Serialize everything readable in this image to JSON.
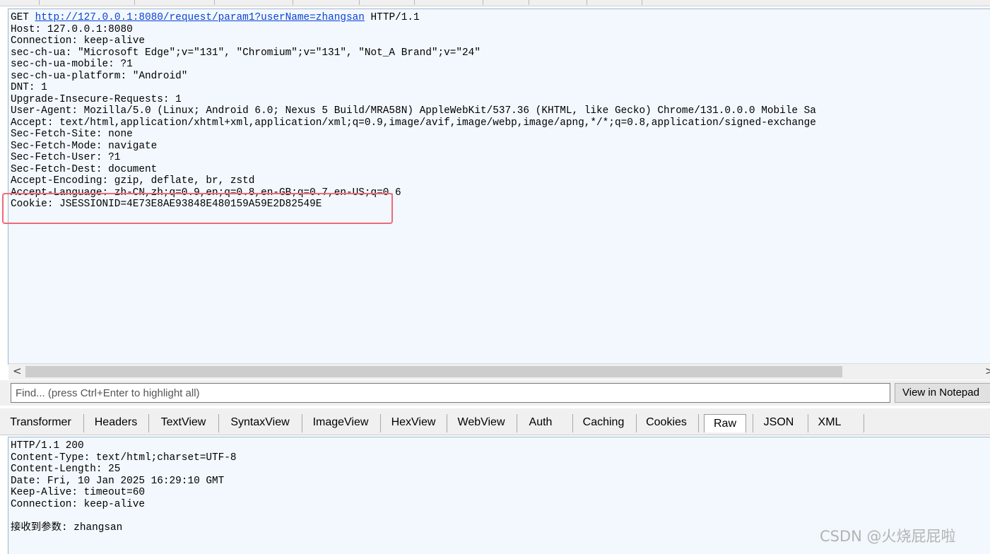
{
  "request": {
    "method": "GET",
    "url": "http://127.0.0.1:8080/request/param1?userName=zhangsan",
    "protocol": "HTTP/1.1",
    "headers": [
      "Host: 127.0.0.1:8080",
      "Connection: keep-alive",
      "sec-ch-ua: \"Microsoft Edge\";v=\"131\", \"Chromium\";v=\"131\", \"Not_A Brand\";v=\"24\"",
      "sec-ch-ua-mobile: ?1",
      "sec-ch-ua-platform: \"Android\"",
      "DNT: 1",
      "Upgrade-Insecure-Requests: 1",
      "User-Agent: Mozilla/5.0 (Linux; Android 6.0; Nexus 5 Build/MRA58N) AppleWebKit/537.36 (KHTML, like Gecko) Chrome/131.0.0.0 Mobile Sa",
      "Accept: text/html,application/xhtml+xml,application/xml;q=0.9,image/avif,image/webp,image/apng,*/*;q=0.8,application/signed-exchange",
      "Sec-Fetch-Site: none",
      "Sec-Fetch-Mode: navigate",
      "Sec-Fetch-User: ?1",
      "Sec-Fetch-Dest: document",
      "Accept-Encoding: gzip, deflate, br, zstd",
      "Accept-Language: zh-CN,zh;q=0.9,en;q=0.8,en-GB;q=0.7,en-US;q=0.6",
      "Cookie: JSESSIONID=4E73E8AE93848E480159A59E2D82549E"
    ]
  },
  "scrollbar": {
    "left_arrow": "<",
    "right_arrow": ">"
  },
  "find": {
    "placeholder": "Find... (press Ctrl+Enter to highlight all)",
    "notepad_label": "View in Notepad"
  },
  "response_tabs": [
    "Transformer",
    "Headers",
    "TextView",
    "SyntaxView",
    "ImageView",
    "HexView",
    "WebView",
    "Auth",
    "Caching",
    "Cookies",
    "Raw",
    "JSON",
    "XML"
  ],
  "active_tab": "Raw",
  "response": {
    "lines": [
      "HTTP/1.1 200",
      "Content-Type: text/html;charset=UTF-8",
      "Content-Length: 25",
      "Date: Fri, 10 Jan 2025 16:29:10 GMT",
      "Keep-Alive: timeout=60",
      "Connection: keep-alive",
      "",
      "接收到参数: zhangsan"
    ]
  },
  "watermark": "CSDN @火烧屁屁啦",
  "colors": {
    "highlight_box": "#f06a77",
    "link": "#0b43d6",
    "pane_bg": "#f2f8fd"
  }
}
